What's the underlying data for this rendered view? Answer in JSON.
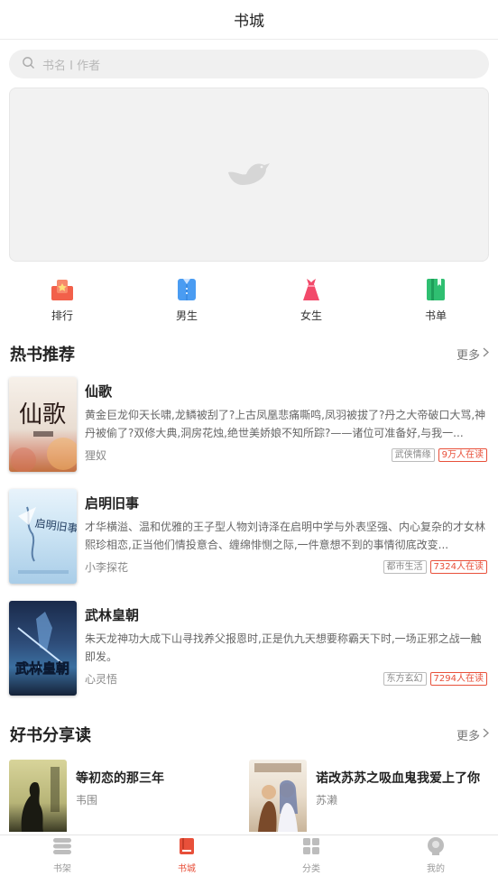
{
  "header": {
    "title": "书城"
  },
  "search": {
    "placeholder": "书名 I 作者"
  },
  "categories": [
    {
      "label": "排行",
      "icon": "ranking-icon",
      "color": "#f2604a"
    },
    {
      "label": "男生",
      "icon": "shirt-icon",
      "color": "#4a9cf2"
    },
    {
      "label": "女生",
      "icon": "dress-icon",
      "color": "#f24a6a"
    },
    {
      "label": "书单",
      "icon": "booklist-icon",
      "color": "#2fbf71"
    }
  ],
  "hot": {
    "title": "热书推荐",
    "more": "更多",
    "books": [
      {
        "title": "仙歌",
        "desc": "黄金巨龙仰天长啸,龙鳞被刮了?上古凤凰悲痛嘶鸣,凤羽被拔了?丹之大帝破口大骂,神丹被偷了?双修大典,洞房花烛,绝世美娇娘不知所踪?——诸位可准备好,与我一...",
        "author": "狸奴",
        "genre": "武侠情缘",
        "readers": "9万人在读",
        "cover_text": "仙歌"
      },
      {
        "title": "启明旧事",
        "desc": "才华横溢、温和优雅的王子型人物刘诗泽在启明中学与外表坚强、内心复杂的才女林熙珍相恋,正当他们情投意合、缠绵悱恻之际,一件意想不到的事情彻底改变...",
        "author": "小李探花",
        "genre": "都市生活",
        "readers": "7324人在读",
        "cover_text": "启明旧事"
      },
      {
        "title": "武林皇朝",
        "desc": "朱天龙神功大成下山寻找养父报恩时,正是仇九天想要称霸天下时,一场正邪之战一触即发。",
        "author": "心灵悟",
        "genre": "东方玄幻",
        "readers": "7294人在读",
        "cover_text": "武林皇朝"
      }
    ]
  },
  "share": {
    "title": "好书分享读",
    "more": "更多",
    "books": [
      {
        "title": "等初恋的那三年",
        "author": "韦围"
      },
      {
        "title": "诺改苏苏之吸血鬼我爱上了你",
        "author": "苏濑"
      }
    ]
  },
  "tabbar": [
    {
      "label": "书架",
      "icon": "bookshelf-icon",
      "active": false
    },
    {
      "label": "书城",
      "icon": "bookstore-icon",
      "active": true
    },
    {
      "label": "分类",
      "icon": "category-icon",
      "active": false
    },
    {
      "label": "我的",
      "icon": "profile-icon",
      "active": false
    }
  ],
  "colors": {
    "accent": "#e8503a"
  }
}
